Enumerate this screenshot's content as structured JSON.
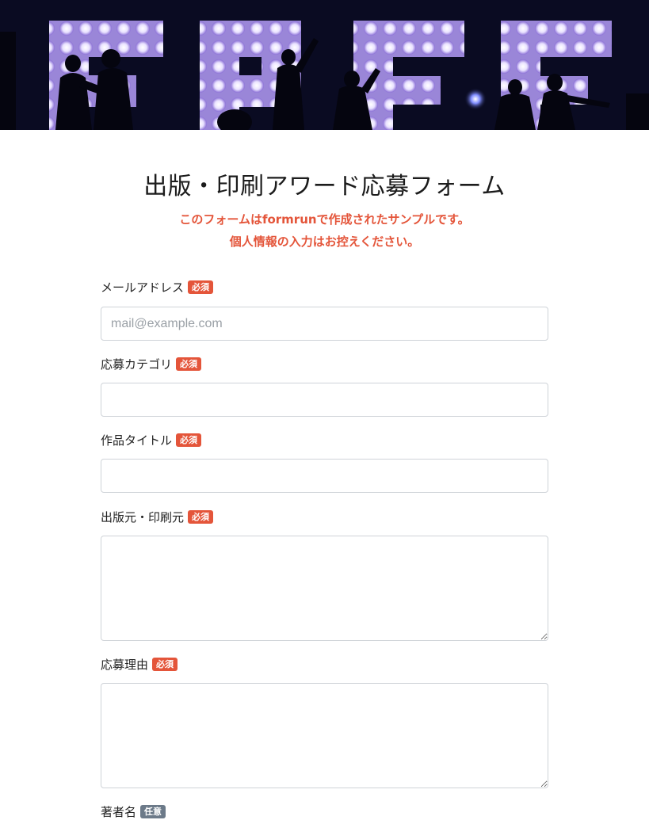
{
  "header": {
    "banner_image": "stage-concert-letters-banner"
  },
  "form": {
    "title": "出版・印刷アワード応募フォーム",
    "notice_line1": "このフォームはformrunで作成されたサンプルです。",
    "notice_line2": "個人情報の入力はお控えください。",
    "required_label": "必須",
    "optional_label": "任意",
    "fields": [
      {
        "label": "メールアドレス",
        "required": true,
        "type": "email",
        "placeholder": "mail@example.com",
        "value": ""
      },
      {
        "label": "応募カテゴリ",
        "required": true,
        "type": "text",
        "placeholder": "",
        "value": ""
      },
      {
        "label": "作品タイトル",
        "required": true,
        "type": "text",
        "placeholder": "",
        "value": ""
      },
      {
        "label": "出版元・印刷元",
        "required": true,
        "type": "textarea",
        "placeholder": "",
        "value": ""
      },
      {
        "label": "応募理由",
        "required": true,
        "type": "textarea",
        "placeholder": "",
        "value": ""
      },
      {
        "label": "著者名",
        "required": false,
        "type": "text",
        "placeholder": "",
        "value": ""
      }
    ]
  },
  "colors": {
    "accent": "#e4553a",
    "optional_badge": "#6c7a89",
    "banner_bg": "#0a0b22"
  }
}
